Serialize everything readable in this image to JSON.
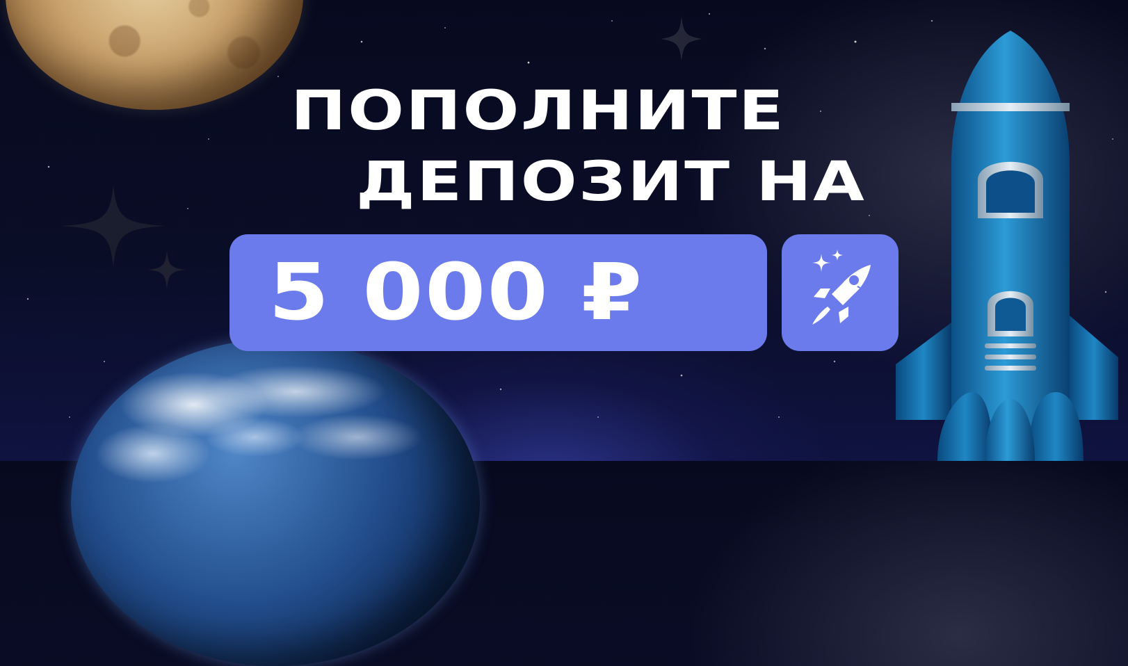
{
  "promo": {
    "headline_line1": "ПОПОЛНИТЕ",
    "headline_line2": "ДЕПОЗИТ НА",
    "amount": "5 000 ₽"
  },
  "icons": {
    "badge": "rocket-gift-icon",
    "decor": [
      "moon-planet",
      "earth-planet",
      "spaceship-rocket",
      "sparkle-star"
    ]
  },
  "colors": {
    "background": "#070a1f",
    "accent": "#6b7bec",
    "text": "#ffffff",
    "rocket": "#1f7fb8"
  }
}
